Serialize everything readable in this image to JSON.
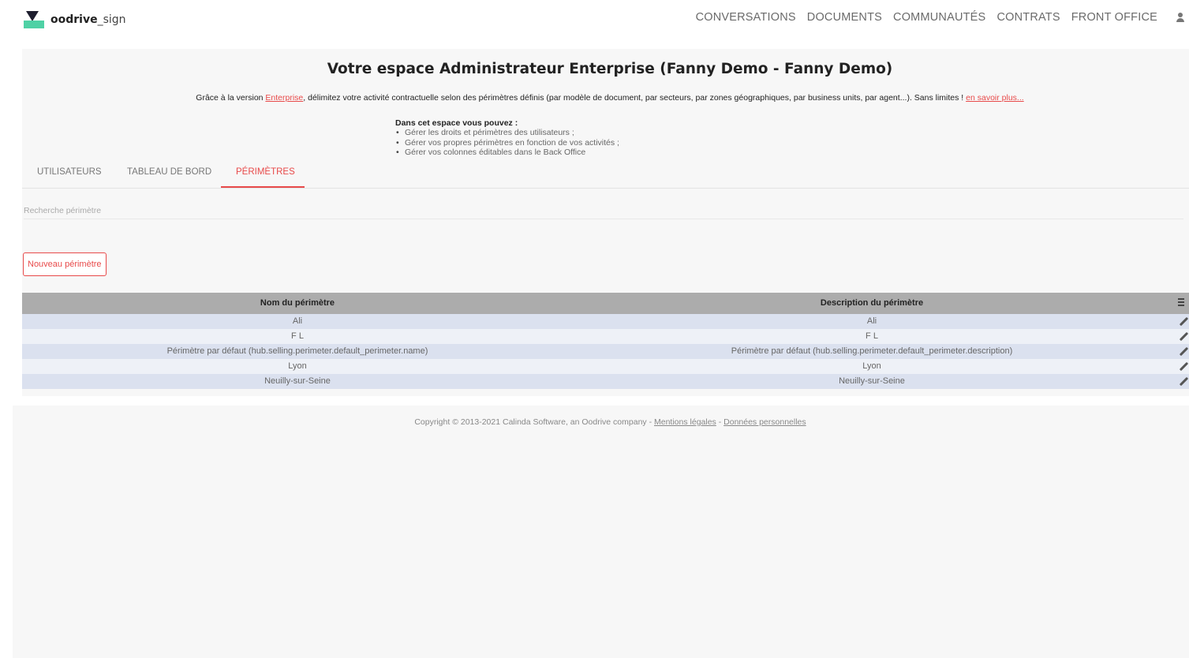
{
  "brand": {
    "name_bold": "oodrive",
    "name_light": "_sign"
  },
  "nav": [
    {
      "label": "CONVERSATIONS"
    },
    {
      "label": "DOCUMENTS"
    },
    {
      "label": "COMMUNAUTÉS"
    },
    {
      "label": "CONTRATS"
    },
    {
      "label": "FRONT OFFICE"
    }
  ],
  "page": {
    "title": "Votre espace Administrateur Enterprise (Fanny Demo - Fanny Demo)",
    "intro_before": "Grâce à la version ",
    "intro_link": "Enterprise",
    "intro_middle": ", délimitez votre activité contractuelle selon des périmètres définis (par modèle de document, par secteurs, par zones géographiques, par business units, par agent...). Sans limites ! ",
    "intro_more": "en savoir plus...",
    "capabilities_title": "Dans cet espace vous pouvez :",
    "capabilities": [
      "Gérer les droits et périmètres des utilisateurs ;",
      "Gérer vos propres périmètres en fonction de vos activités ;",
      "Gérer vos colonnes éditables dans le Back Office"
    ]
  },
  "tabs": [
    {
      "label": "UTILISATEURS"
    },
    {
      "label": "TABLEAU DE BORD"
    },
    {
      "label": "PÉRIMÈTRES"
    }
  ],
  "search": {
    "placeholder": "Recherche périmètre"
  },
  "new_button": "Nouveau périmètre",
  "table": {
    "headers": [
      "Nom du périmètre",
      "Description du périmètre"
    ],
    "rows": [
      [
        "Ali",
        "Ali"
      ],
      [
        "F L",
        "F L"
      ],
      [
        "Périmètre par défaut (hub.selling.perimeter.default_perimeter.name)",
        "Périmètre par défaut (hub.selling.perimeter.default_perimeter.description)"
      ],
      [
        "Lyon",
        "Lyon"
      ],
      [
        "Neuilly-sur-Seine",
        "Neuilly-sur-Seine"
      ]
    ]
  },
  "footer": {
    "copyright": "Copyright © 2013-2021 Calinda Software, an Oodrive company - ",
    "legal": "Mentions légales",
    "sep": " - ",
    "privacy": "Données personnelles"
  },
  "colors": {
    "accent": "#e84a4a",
    "logo_green": "#4fd1a5",
    "header_bg": "#acacac"
  }
}
